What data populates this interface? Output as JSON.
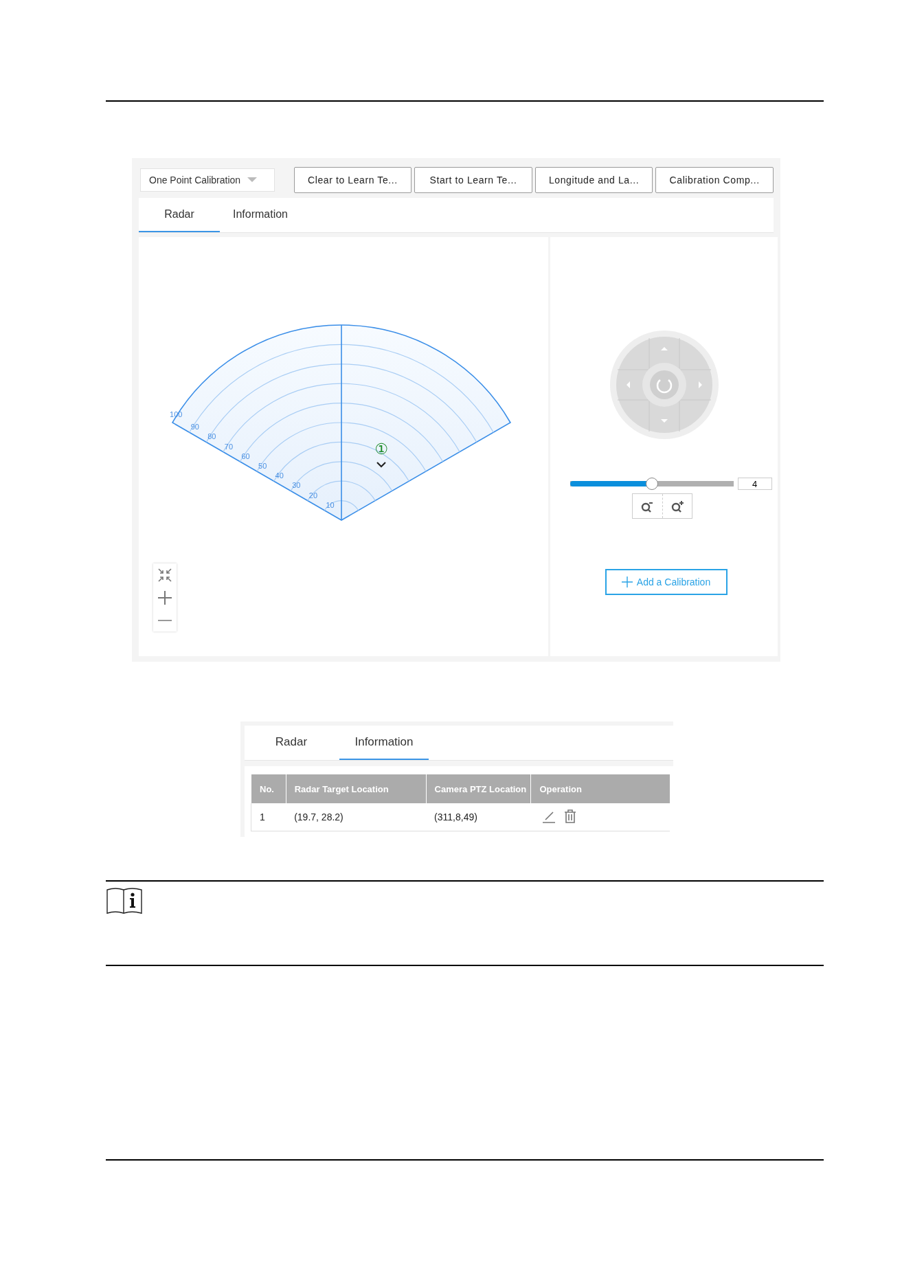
{
  "calibration_view": {
    "mode_dropdown": {
      "value": "One Point Calibration"
    },
    "buttons": [
      "Clear to Learn Te...",
      "Start to Learn Te...",
      "Longitude and La...",
      "Calibration Comp..."
    ],
    "tabs": [
      {
        "label": "Radar",
        "selected": true
      },
      {
        "label": "Information",
        "selected": false
      }
    ],
    "radar": {
      "range_labels": [
        "10",
        "20",
        "30",
        "40",
        "50",
        "60",
        "70",
        "80",
        "90",
        "100"
      ],
      "target_marker": "①"
    },
    "ptz": {
      "zoom_slider": {
        "level": 0.5
      },
      "zoom_value": "4"
    },
    "add_button": "Add a Calibration"
  },
  "information_view": {
    "tabs": [
      {
        "label": "Radar",
        "selected": false
      },
      {
        "label": "Information",
        "selected": true
      }
    ],
    "table": {
      "columns": [
        "No.",
        "Radar Target Location",
        "Camera PTZ Location",
        "Operation"
      ],
      "rows": [
        [
          "1",
          "(19.7, 28.2)",
          "(311,8,49)"
        ]
      ]
    }
  }
}
